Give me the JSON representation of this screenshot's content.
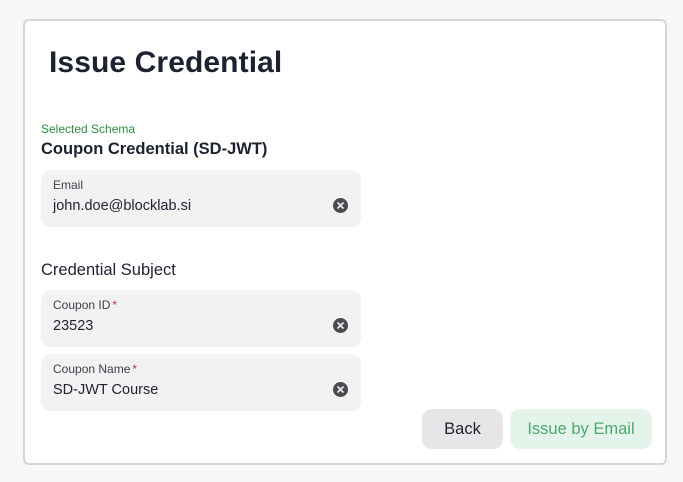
{
  "page": {
    "title": "Issue Credential"
  },
  "schema": {
    "label": "Selected Schema",
    "name": "Coupon Credential (SD-JWT)"
  },
  "email_field": {
    "label": "Email",
    "value": "john.doe@blocklab.si",
    "clear_icon": "clear-circle-icon"
  },
  "subject": {
    "title": "Credential Subject",
    "fields": [
      {
        "label": "Coupon ID",
        "required_marker": "*",
        "value": "23523",
        "clear_icon": "clear-circle-icon"
      },
      {
        "label": "Coupon Name",
        "required_marker": "*",
        "value": "SD-JWT Course",
        "clear_icon": "clear-circle-icon"
      }
    ]
  },
  "actions": {
    "back_label": "Back",
    "issue_label": "Issue by Email"
  },
  "colors": {
    "accent_green": "#2e8b3f",
    "issue_button_bg": "#e5f4ea",
    "issue_button_text": "#4da86b",
    "required_red": "#c62a44"
  }
}
